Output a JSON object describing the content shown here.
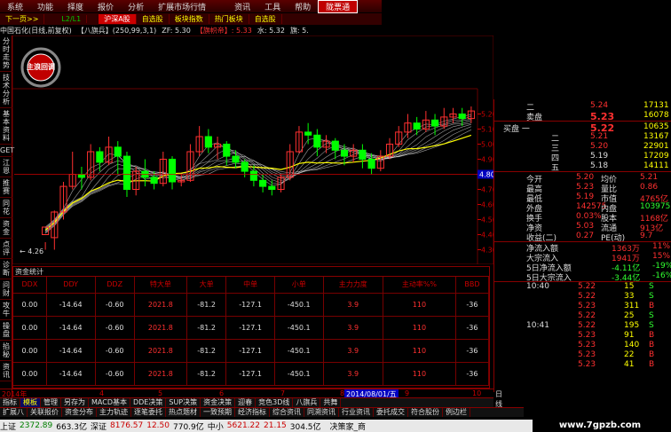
{
  "menu": {
    "items": [
      "系统",
      "功能",
      "择度",
      "报价",
      "分析",
      "扩展市场行情",
      "",
      "资讯",
      "工具",
      "帮助",
      "陇票通"
    ],
    "active_index": 10
  },
  "toolbar": {
    "items": [
      "下一页>>",
      "",
      "L2/L1",
      "",
      "沪深A股",
      "自选股",
      "板块指数",
      "热门板块",
      "自选股"
    ]
  },
  "infoline": {
    "stock": "中国石化(日线,前复权)",
    "indicator": "【八旗兵】(250,99,3,1)",
    "zf": "ZF: 5.30",
    "flag": "【旗帜帝】: 5.33",
    "water": "水: 5.32",
    "qi": "旗: 5."
  },
  "left_tabs": [
    "分时走势",
    "技术分析",
    "基本资料",
    "GET",
    "江恩",
    "推赛",
    "同花",
    "资金",
    "点评",
    "诊断",
    "问财",
    "攻牛",
    "操盘",
    "掐秘",
    "资讯"
  ],
  "logo_text": "主浪回调",
  "chart_data": {
    "type": "candlestick",
    "yaxis_ticks": [
      "5.20",
      "5.10",
      "5.00",
      "4.90",
      "4.80",
      "4.70",
      "4.60",
      "4.50",
      "4.40",
      "4.30"
    ],
    "ylim": [
      4.25,
      5.25
    ],
    "price_marker": "4.80",
    "low_label": "4.26",
    "candles": [
      [
        4.4,
        4.45,
        4.35,
        4.3
      ],
      [
        4.38,
        4.55,
        4.56,
        4.3
      ],
      [
        4.55,
        4.72,
        4.75,
        4.5
      ],
      [
        4.72,
        4.8,
        4.95,
        4.7
      ],
      [
        4.8,
        4.78,
        4.85,
        4.7
      ],
      [
        4.78,
        4.95,
        5.0,
        4.76
      ],
      [
        4.95,
        4.88,
        4.98,
        4.82
      ],
      [
        4.88,
        4.98,
        5.05,
        4.86
      ],
      [
        4.98,
        4.92,
        5.02,
        4.8
      ],
      [
        4.92,
        4.7,
        4.95,
        4.65
      ],
      [
        4.7,
        4.82,
        4.85,
        4.66
      ],
      [
        4.82,
        4.78,
        4.9,
        4.72
      ],
      [
        4.78,
        4.74,
        4.82,
        4.7
      ],
      [
        4.74,
        4.9,
        4.95,
        4.72
      ],
      [
        4.9,
        4.75,
        4.92,
        4.7
      ],
      [
        4.75,
        4.76,
        4.8,
        4.72
      ],
      [
        4.76,
        4.95,
        5.0,
        4.75
      ],
      [
        4.95,
        5.05,
        5.12,
        4.92
      ],
      [
        5.05,
        4.98,
        5.1,
        4.94
      ],
      [
        4.98,
        5.0,
        5.05,
        4.9
      ],
      [
        5.0,
        4.92,
        5.02,
        4.86
      ],
      [
        4.92,
        4.88,
        4.96,
        4.84
      ],
      [
        4.88,
        4.82,
        4.9,
        4.78
      ],
      [
        4.82,
        4.76,
        4.86,
        4.72
      ],
      [
        4.76,
        4.72,
        4.8,
        4.68
      ],
      [
        4.72,
        4.7,
        4.76,
        4.66
      ],
      [
        4.7,
        4.78,
        4.8,
        4.68
      ],
      [
        4.78,
        4.95,
        5.0,
        4.76
      ],
      [
        4.95,
        5.08,
        5.12,
        4.94
      ],
      [
        5.08,
        5.06,
        5.14,
        5.0
      ],
      [
        5.06,
        4.98,
        5.1,
        4.92
      ],
      [
        4.98,
        5.02,
        5.06,
        4.94
      ],
      [
        5.02,
        4.96,
        5.04,
        4.9
      ],
      [
        4.96,
        4.92,
        5.0,
        4.86
      ],
      [
        4.92,
        4.96,
        5.0,
        4.88
      ],
      [
        4.96,
        4.9,
        5.0,
        4.84
      ],
      [
        4.9,
        4.84,
        4.94,
        4.8
      ],
      [
        4.84,
        4.92,
        4.96,
        4.82
      ],
      [
        4.92,
        5.0,
        5.04,
        4.9
      ],
      [
        5.0,
        5.08,
        5.12,
        4.98
      ],
      [
        5.08,
        5.14,
        5.2,
        5.04
      ],
      [
        5.14,
        5.1,
        5.18,
        5.06
      ],
      [
        5.1,
        5.16,
        5.22,
        5.08
      ],
      [
        5.16,
        5.12,
        5.2,
        5.06
      ],
      [
        5.12,
        5.18,
        5.24,
        5.1
      ],
      [
        5.18,
        5.2,
        5.24,
        5.14
      ],
      [
        5.2,
        5.17,
        5.24,
        5.12
      ],
      [
        5.17,
        5.22,
        5.25,
        5.14
      ]
    ]
  },
  "capital": {
    "caption": "资金统计",
    "headers": [
      "DDX",
      "DDY",
      "DDZ",
      "特大单",
      "大单",
      "中单",
      "小单",
      "主力力度",
      "主动率%%",
      "BBD"
    ],
    "rows": [
      [
        "0.00",
        "-14.64",
        "-0.60",
        "2021.8",
        "-81.2",
        "-127.1",
        "-450.1",
        "3.9",
        "110",
        "-36"
      ],
      [
        "0.00",
        "-14.64",
        "-0.60",
        "2021.8",
        "-81.2",
        "-127.1",
        "-450.1",
        "3.9",
        "110",
        "-36"
      ],
      [
        "0.00",
        "-14.64",
        "-0.60",
        "2021.8",
        "-81.2",
        "-127.1",
        "-450.1",
        "3.9",
        "110",
        "-36"
      ],
      [
        "0.00",
        "-14.64",
        "-0.60",
        "2021.8",
        "-81.2",
        "-127.1",
        "-450.1",
        "3.9",
        "110",
        "-36"
      ]
    ]
  },
  "datebar": {
    "year": "2014年",
    "marks": [
      "4",
      "5",
      "6",
      "7",
      "8",
      "9",
      "10"
    ],
    "selected": "2014/08/01/五",
    "period": "日线"
  },
  "bottom_tabs1": [
    "指标",
    "模板",
    "管理",
    "另存为",
    "MACD基本",
    "DDE决策",
    "SUP决策",
    "资金决策",
    "迎春",
    "竞色3D线",
    "八旗兵",
    "共舞"
  ],
  "bottom_tabs2": [
    "扩展八",
    "关联报价",
    "资金分布",
    "主力轨迹",
    "逐笔委托",
    "热点题材",
    "一致预期",
    "经济指标",
    "综合资讯",
    "同溯资讯",
    "行业资讯",
    "委托成交",
    "符合股份",
    "例边栏"
  ],
  "status": {
    "sh_label": "上证",
    "sh_value": "2372.89",
    "sh_amount": "663.3亿",
    "sz_label": "深证",
    "sz_value": "8176.57",
    "sz_change": "12.50",
    "sz_amount": "770.9亿",
    "zx_label": "中小",
    "zx_value": "5621.22",
    "zx_change": "21.15",
    "zx_amount": "304.5亿",
    "right": "决策家_商"
  },
  "watermark": "www.7gpzb.com",
  "orderbook": {
    "sell": [
      {
        "label": "二",
        "price": "5.24",
        "vol": "17131"
      },
      {
        "label": "卖盘",
        "price": "5.23",
        "vol": "16078"
      }
    ],
    "buy": [
      {
        "label": "买盘 一",
        "price": "5.22",
        "vol": "10635"
      },
      {
        "label": "二",
        "price": "5.21",
        "vol": "13167"
      },
      {
        "label": "三",
        "price": "5.20",
        "vol": "22901"
      },
      {
        "label": "四",
        "price": "5.19",
        "vol": "17209"
      },
      {
        "label": "五",
        "price": "5.18",
        "vol": "14111"
      }
    ],
    "stats": [
      [
        "今开",
        "5.20",
        "均价",
        "5.21"
      ],
      [
        "最高",
        "5.23",
        "量比",
        "0.86"
      ],
      [
        "最低",
        "5.19",
        "市值",
        "4765亿"
      ],
      [
        "外盘",
        "142575",
        "内盘",
        "103975"
      ],
      [
        "换手",
        "0.03%",
        "股本",
        "1168亿"
      ],
      [
        "净资",
        "5.03",
        "流通",
        "913亿"
      ],
      [
        "收益(二)",
        "0.27",
        "PE(动)",
        "9.7"
      ]
    ],
    "flows": [
      [
        "净流入额",
        "1363万",
        "11%"
      ],
      [
        "大宗流入",
        "1941万",
        "15%"
      ],
      [
        "5日净流入额",
        "-4.11亿",
        "-19%"
      ],
      [
        "5日大宗流入",
        "-3.44亿",
        "-16%"
      ]
    ],
    "ticks": [
      [
        "10:40",
        "5.22",
        "15",
        "S"
      ],
      [
        "",
        "5.22",
        "33",
        "S"
      ],
      [
        "",
        "5.23",
        "311",
        "B"
      ],
      [
        "",
        "5.22",
        "25",
        "S"
      ],
      [
        "10:41",
        "5.22",
        "195",
        "S"
      ],
      [
        "",
        "5.23",
        "91",
        "B"
      ],
      [
        "",
        "5.23",
        "140",
        "B"
      ],
      [
        "",
        "5.23",
        "22",
        "B"
      ],
      [
        "",
        "5.23",
        "41",
        "B"
      ]
    ]
  },
  "colors": {
    "up": "#ff3030",
    "down": "#00ff00",
    "ma": "#ffff00",
    "grid": "#800000"
  }
}
